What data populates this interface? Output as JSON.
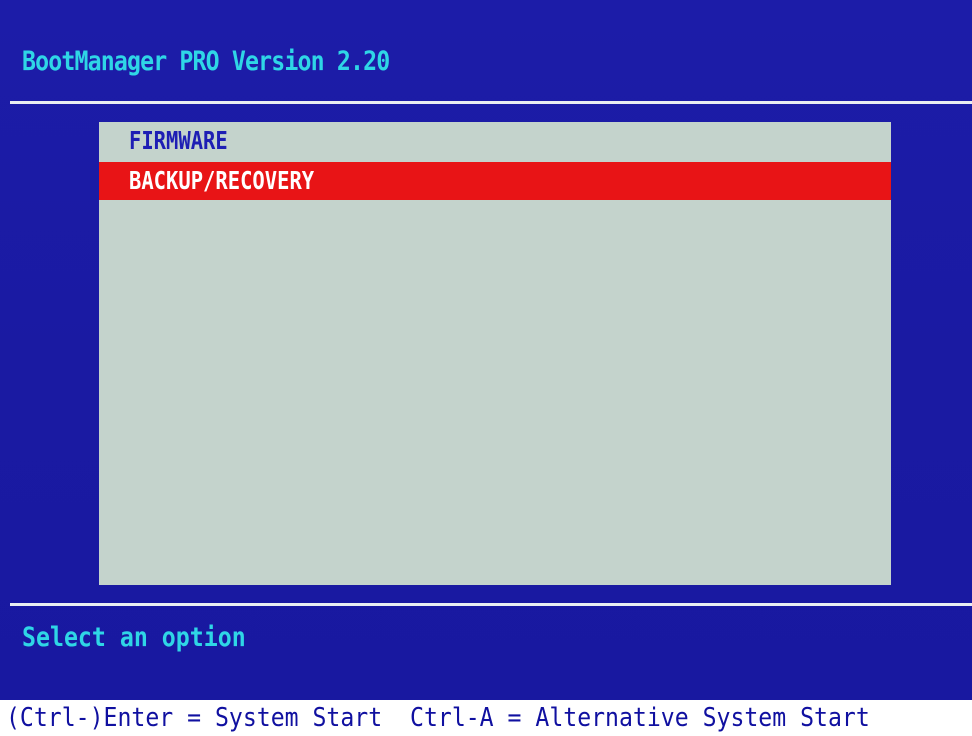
{
  "header": {
    "title": "BootManager PRO Version 2.20"
  },
  "menu": {
    "items": [
      {
        "label": "FIRMWARE",
        "selected": false
      },
      {
        "label": "BACKUP/RECOVERY",
        "selected": true
      }
    ]
  },
  "status": {
    "prompt": "Select an option"
  },
  "footer": {
    "hint_enter": "(Ctrl-)Enter = System Start",
    "hint_ctrl_a": "Ctrl-A = Alternative System Start"
  },
  "colors": {
    "background": "#1a1aa2",
    "title_text": "#2fd6e6",
    "menu_panel": "#c4d3cc",
    "menu_text": "#1e1eb4",
    "selection_bar": "#e81416",
    "selection_text": "#ffffff",
    "footer_background": "#ffffff",
    "footer_text": "#1010a0"
  }
}
